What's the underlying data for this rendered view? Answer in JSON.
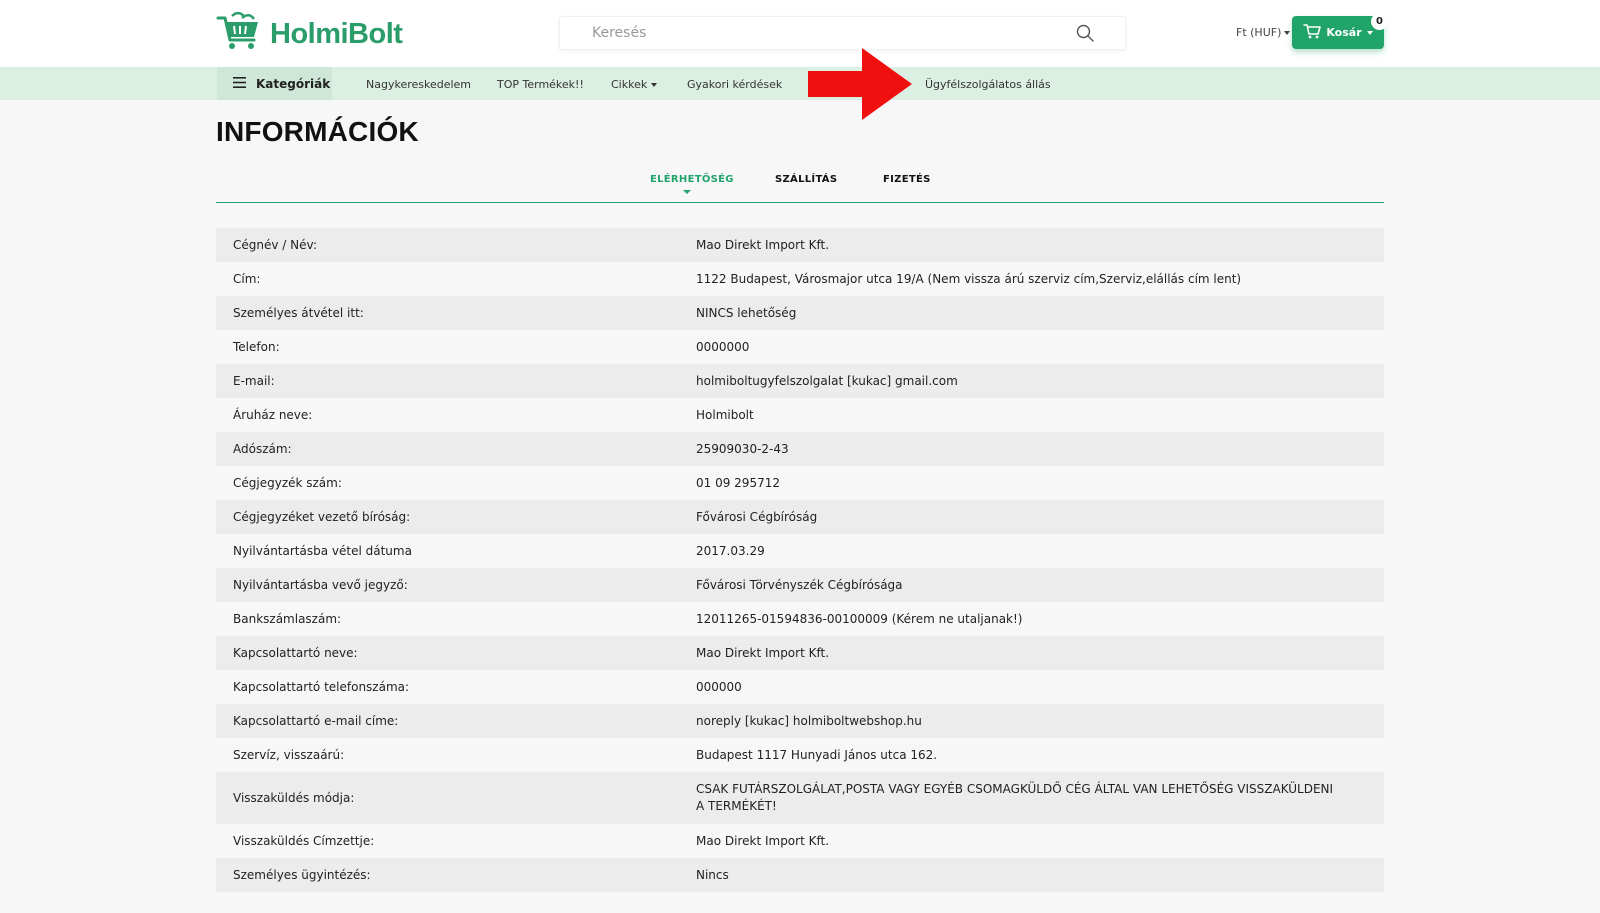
{
  "header": {
    "logo_text": "HolmiBolt",
    "search_placeholder": "Keresés",
    "currency": "Ft (HUF)",
    "cart_label": "Kosár",
    "cart_count": "0",
    "accent_color": "#21a46a"
  },
  "nav": {
    "categories": "Kategóriák",
    "links": [
      "Nagykereskedelem",
      "TOP Termékek!!",
      "Cikkek",
      "Gyakori kérdések",
      "Ügyfélszolgálatos állás"
    ]
  },
  "page": {
    "title": "INFORMÁCIÓK",
    "tabs": [
      "ELÉRHETŐSÉG",
      "SZÁLLÍTÁS",
      "FIZETÉS"
    ],
    "active_tab": "ELÉRHETŐSÉG"
  },
  "info": [
    {
      "label": "Cégnév / Név:",
      "value": "Mao Direkt Import Kft."
    },
    {
      "label": "Cím:",
      "value": "1122 Budapest, Városmajor utca 19/A (Nem vissza árú szerviz cím,Szerviz,elállás cím lent)"
    },
    {
      "label": "Személyes átvétel itt:",
      "value": "NINCS lehetőség"
    },
    {
      "label": "Telefon:",
      "value": "0000000"
    },
    {
      "label": "E-mail:",
      "value": "holmiboltugyfelszolgalat [kukac] gmail.com"
    },
    {
      "label": "Áruház neve:",
      "value": "Holmibolt"
    },
    {
      "label": "Adószám:",
      "value": "25909030-2-43"
    },
    {
      "label": "Cégjegyzék szám:",
      "value": "01 09 295712"
    },
    {
      "label": "Cégjegyzéket vezető bíróság:",
      "value": "Fővárosi Cégbíróság"
    },
    {
      "label": "Nyilvántartásba vétel dátuma",
      "value": "2017.03.29"
    },
    {
      "label": "Nyilvántartásba vevő jegyző:",
      "value": "Fővárosi Törvényszék Cégbírósága"
    },
    {
      "label": "Bankszámlaszám:",
      "value": "12011265-01594836-00100009 (Kérem ne utaljanak!)"
    },
    {
      "label": "Kapcsolattartó neve:",
      "value": "Mao Direkt Import Kft."
    },
    {
      "label": "Kapcsolattartó telefonszáma:",
      "value": "000000"
    },
    {
      "label": "Kapcsolattartó e-mail címe:",
      "value": "noreply [kukac] holmiboltwebshop.hu"
    },
    {
      "label": "Szervíz, visszaárú:",
      "value": "Budapest 1117 Hunyadi János utca 162."
    },
    {
      "label": "Visszaküldés módja:",
      "value": "CSAK FUTÁRSZOLGÁLAT,POSTA VAGY EGYÉB CSOMAGKÜLDŐ CÉG ÁLTAL VAN LEHETŐSÉG VISSZAKÜLDENI A TERMÉKÉT!"
    },
    {
      "label": "Visszaküldés Címzettje:",
      "value": "Mao Direkt Import Kft."
    },
    {
      "label": "Személyes ügyintézés:",
      "value": "Nincs"
    }
  ]
}
